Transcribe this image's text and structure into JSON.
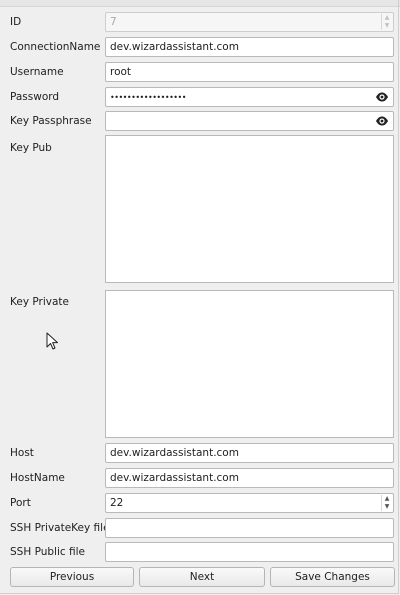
{
  "form": {
    "id": {
      "label": "ID",
      "value": "7"
    },
    "connection_name": {
      "label": "ConnectionName",
      "value": "dev.wizardassistant.com"
    },
    "username": {
      "label": "Username",
      "value": "root"
    },
    "password": {
      "label": "Password",
      "value": "••••••••••••••••••"
    },
    "key_passphrase": {
      "label": "Key Passphrase",
      "value": ""
    },
    "key_pub": {
      "label": "Key Pub",
      "value": ""
    },
    "key_private": {
      "label": "Key Private",
      "value": ""
    },
    "host": {
      "label": "Host",
      "value": "dev.wizardassistant.com"
    },
    "host_name": {
      "label": "HostName",
      "value": "dev.wizardassistant.com"
    },
    "port": {
      "label": "Port",
      "value": "22"
    },
    "ssh_private_key_file": {
      "label": "SSH PrivateKey file",
      "value": ""
    },
    "ssh_public_file": {
      "label": "SSH Public file",
      "value": ""
    }
  },
  "buttons": {
    "previous": "Previous",
    "next": "Next",
    "save": "Save Changes"
  },
  "icons": {
    "show_password": "eye-icon",
    "show_passphrase": "eye-icon",
    "spinner_up": "chevron-up-icon",
    "spinner_down": "chevron-down-icon",
    "pointer": "mouse-cursor-icon"
  }
}
